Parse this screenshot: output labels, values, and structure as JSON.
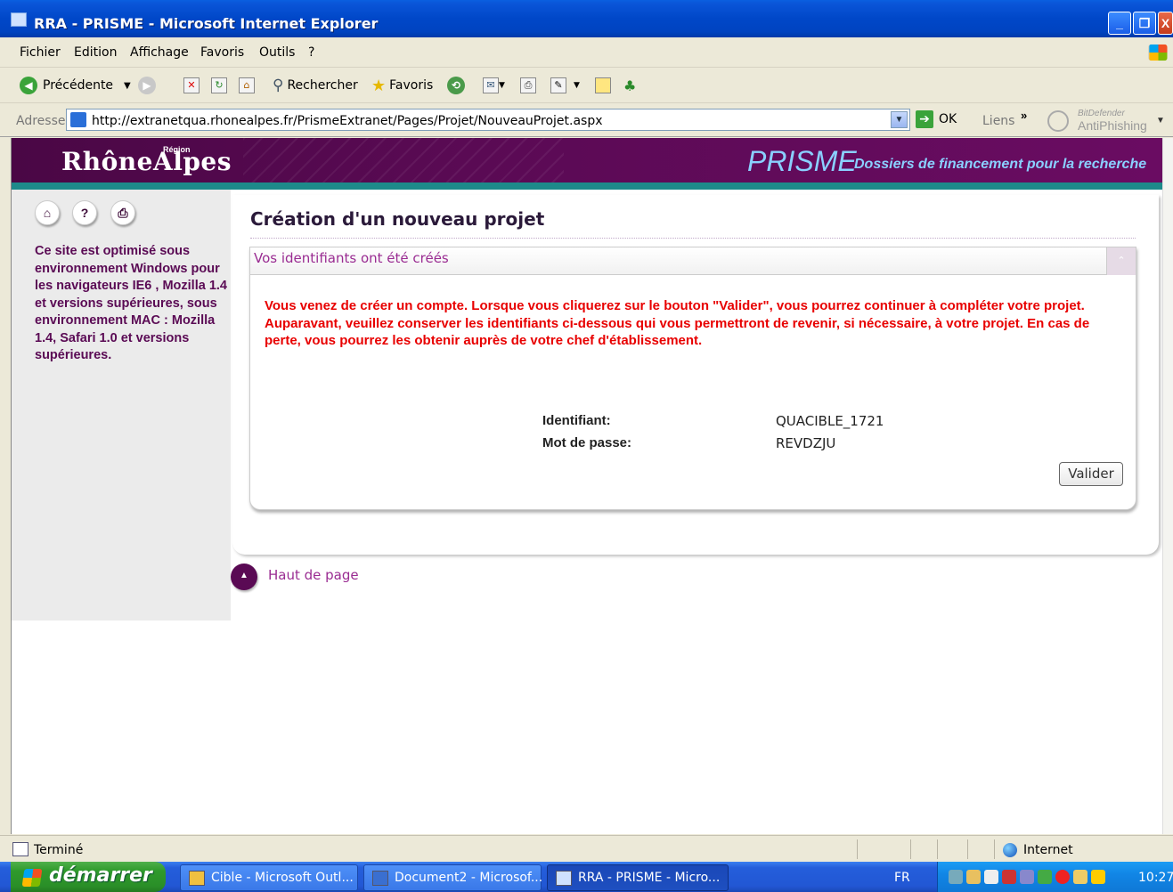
{
  "window": {
    "title": "RRA - PRISME - Microsoft Internet Explorer",
    "min_label": "_",
    "restore_label": "❐",
    "close_label": "X"
  },
  "menu": {
    "items": [
      "Fichier",
      "Edition",
      "Affichage",
      "Favoris",
      "Outils",
      "?"
    ]
  },
  "toolbar": {
    "back_label": "Précédente",
    "search_label": "Rechercher",
    "favorites_label": "Favoris"
  },
  "address": {
    "label": "Adresse",
    "url": "http://extranetqua.rhonealpes.fr/PrismeExtranet/Pages/Projet/NouveauProjet.aspx",
    "go_label": "OK",
    "links_label": "Liens",
    "chevron": "»",
    "antiphishing_brand": "BitDefender",
    "antiphishing_label": "AntiPhishing"
  },
  "site": {
    "logo": "RhôneAlpes",
    "logo_region": "Région",
    "app_name": "PRISME",
    "app_subtitle": "Dossiers de financement pour la recherche"
  },
  "sidebar": {
    "icons": [
      "home-icon",
      "help-icon",
      "print-icon"
    ],
    "icon_glyphs": [
      "⌂",
      "?",
      "⎙"
    ],
    "notice": "Ce site est optimisé sous environnement Windows pour les navigateurs IE6 , Mozilla 1.4 et versions supérieures, sous environnement MAC : Mozilla 1.4, Safari 1.0 et versions supérieures."
  },
  "main": {
    "page_title": "Création d'un nouveau projet",
    "box_title": "Vos identifiants ont été créés",
    "collapse_glyph": "⌃",
    "warning": "Vous venez de créer un compte. Lorsque vous cliquerez sur le bouton \"Valider\", vous pourrez continuer à compléter votre projet. Auparavant, veuillez conserver les identifiants ci-dessous qui vous permettront de revenir, si nécessaire, à votre projet. En cas de perte, vous pourrez les obtenir auprès de votre chef d'établissement.",
    "credentials": {
      "id_label": "Identifiant:",
      "id_value": "QUACIBLE_1721",
      "password_label": "Mot de passe:",
      "password_value": "REVDZJU"
    },
    "validate_label": "Valider",
    "top_link_label": "Haut de page",
    "top_link_glyph": "▲"
  },
  "statusbar": {
    "status": "Terminé",
    "zone": "Internet"
  },
  "taskbar": {
    "start_label": "démarrer",
    "tasks": [
      "Cible - Microsoft Outl...",
      "Document2 - Microsof...",
      "RRA - PRISME - Micro..."
    ],
    "language": "FR",
    "clock": "10:27"
  },
  "colors": {
    "site_header": "#5a0a54",
    "accent_teal": "#1d8a8a",
    "link_purple": "#9a2c92",
    "warning_red": "#e80000",
    "prisme_blue": "#8ad0ff"
  }
}
